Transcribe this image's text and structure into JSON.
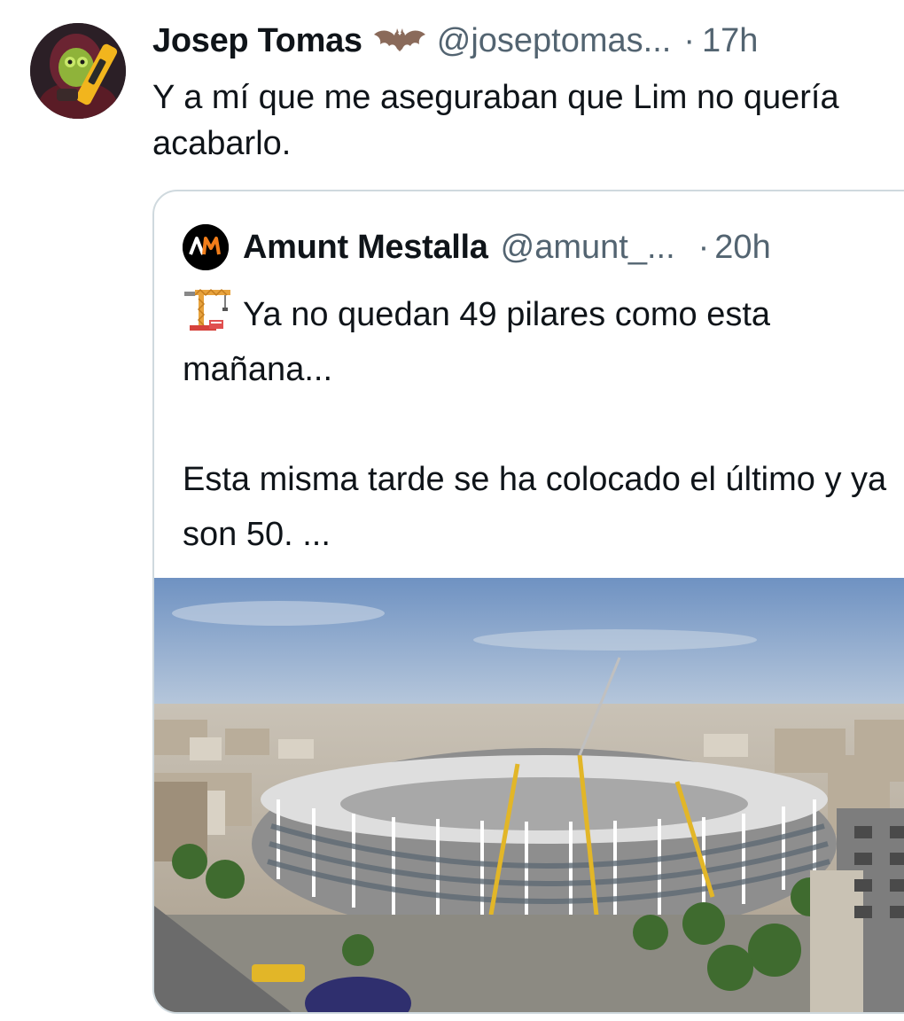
{
  "tweet": {
    "author_name": "Josep Tomas",
    "author_badge_icon": "bat-emoji-icon",
    "handle": "@joseptomas...",
    "separator": "·",
    "time": "17h",
    "text": "Y a mí que me aseguraban que Lim no quería acabarlo."
  },
  "quote": {
    "author_name": "Amunt Mestalla",
    "avatar_text": "AM",
    "handle": "@amunt_...",
    "separator": "·",
    "time": "20h",
    "emoji_icon": "building-construction-icon",
    "line1": "Ya no quedan 49 pilares como esta mañana...",
    "line2": "Esta misma tarde se ha colocado el último y ya son 50. ...",
    "media_icon": "stadium-construction-photo"
  },
  "colors": {
    "text": "#0f1419",
    "secondary": "#536471",
    "border": "#cfd9de"
  }
}
